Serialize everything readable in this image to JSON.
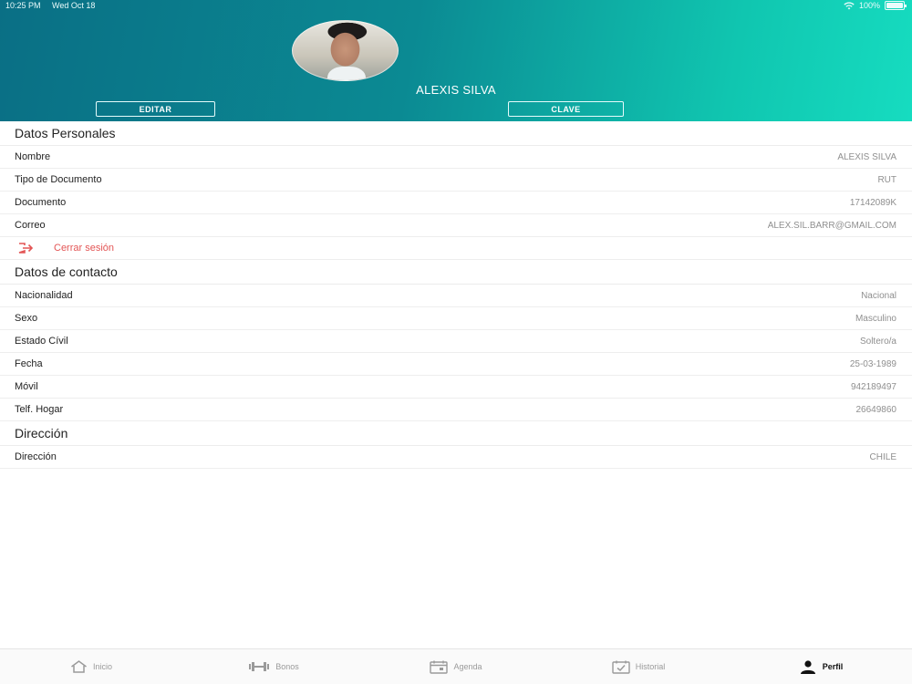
{
  "status_bar": {
    "time": "10:25 PM",
    "date": "Wed Oct 18",
    "battery": "100%"
  },
  "profile": {
    "name": "ALEXIS SILVA",
    "edit_label": "EDITAR",
    "password_label": "CLAVE"
  },
  "personal": {
    "title": "Datos Personales",
    "rows": [
      {
        "label": "Nombre",
        "value": "ALEXIS SILVA"
      },
      {
        "label": "Tipo de Documento",
        "value": "RUT"
      },
      {
        "label": "Documento",
        "value": "17142089K"
      },
      {
        "label": "Correo",
        "value": "ALEX.SIL.BARR@GMAIL.COM"
      }
    ]
  },
  "logout_label": "Cerrar sesión",
  "contact": {
    "title": "Datos de contacto",
    "rows": [
      {
        "label": "Nacionalidad",
        "value": "Nacional"
      },
      {
        "label": "Sexo",
        "value": "Masculino"
      },
      {
        "label": "Estado Cívil",
        "value": "Soltero/a"
      },
      {
        "label": "Fecha",
        "value": "25-03-1989"
      },
      {
        "label": "Móvil",
        "value": "942189497"
      },
      {
        "label": "Telf. Hogar",
        "value": "26649860"
      }
    ]
  },
  "address": {
    "title": "Dirección",
    "rows": [
      {
        "label": "Dirección",
        "value": "CHILE"
      }
    ]
  },
  "tabs": [
    {
      "label": "Inicio",
      "icon": "home-icon"
    },
    {
      "label": "Bonos",
      "icon": "dumbbell-icon"
    },
    {
      "label": "Agenda",
      "icon": "calendar-icon"
    },
    {
      "label": "Historial",
      "icon": "history-icon"
    },
    {
      "label": "Perfil",
      "icon": "person-icon"
    }
  ],
  "colors": {
    "header_start": "#0a6f85",
    "header_end": "#16dcc0",
    "logout": "#e35555"
  }
}
